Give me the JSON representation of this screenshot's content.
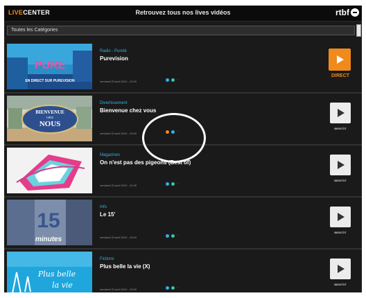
{
  "header": {
    "logo_part1": "LIVE",
    "logo_part2": "CENTER",
    "title": "Retrouvez tous nos lives vidéos",
    "brand": "rtbf"
  },
  "filter": {
    "selected": "Toutes les Catégories"
  },
  "rows": [
    {
      "category": "Radio - Pureté",
      "title": "Purevision",
      "date": "vendredi 23 avril 2010 - 10:00",
      "action": "DIRECT",
      "live": true
    },
    {
      "category": "Divertissement",
      "title": "Bienvenue chez vous",
      "date": "vendredi 23 avril 2010 - 10:00",
      "action": "BIENTÔT",
      "live": false
    },
    {
      "category": "Magazines",
      "title": "On n'est pas des pigeons (Best of)",
      "date": "vendredi 23 avril 2010 - 10:30",
      "action": "BIENTÔT",
      "live": false
    },
    {
      "category": "Info",
      "title": "Le 15'",
      "date": "vendredi 23 avril 2010 - 15:00",
      "action": "BIENTÔT",
      "live": false
    },
    {
      "category": "Fictions",
      "title": "Plus belle la vie (X)",
      "date": "vendredi 23 avril 2010 - 19:00",
      "action": "BIENTÔT",
      "live": false
    }
  ],
  "thumb_texts": {
    "pure": "PURE",
    "pure_sub": "EN DIRECT SUR PUREVISION",
    "bienvenue1": "BIENVENUE",
    "bienvenue2": "CHEZ",
    "bienvenue3": "NOUS",
    "minutes": "minutes",
    "pbv1": "Plus belle",
    "pbv2": "la vie"
  },
  "colors": {
    "accent_orange": "#f08a1c",
    "category_blue": "#2fb3e6",
    "background": "#1a1a1a"
  },
  "icons": [
    "rss-icon",
    "share-icon",
    "tv-icon"
  ]
}
